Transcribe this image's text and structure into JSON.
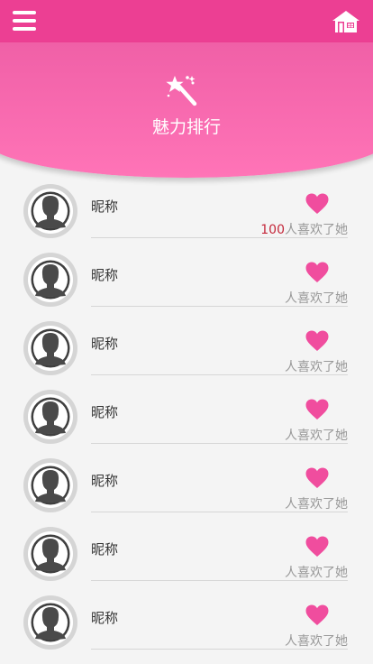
{
  "header": {
    "title": "魅力排行"
  },
  "rows": [
    {
      "nickname": "昵称",
      "count": "100",
      "likes_text": "人喜欢了她"
    },
    {
      "nickname": "昵称",
      "count": "",
      "likes_text": "人喜欢了她"
    },
    {
      "nickname": "昵称",
      "count": "",
      "likes_text": "人喜欢了她"
    },
    {
      "nickname": "昵称",
      "count": "",
      "likes_text": "人喜欢了她"
    },
    {
      "nickname": "昵称",
      "count": "",
      "likes_text": "人喜欢了她"
    },
    {
      "nickname": "昵称",
      "count": "",
      "likes_text": "人喜欢了她"
    },
    {
      "nickname": "昵称",
      "count": "",
      "likes_text": "人喜欢了她"
    }
  ],
  "colors": {
    "accent": "#ec3f93",
    "heart": "#f04d9e",
    "count": "#c4273a"
  },
  "icons": {
    "menu": "menu-icon",
    "home": "home-icon",
    "header": "magic-wand-icon",
    "avatar": "default-avatar-icon",
    "like": "heart-icon"
  }
}
